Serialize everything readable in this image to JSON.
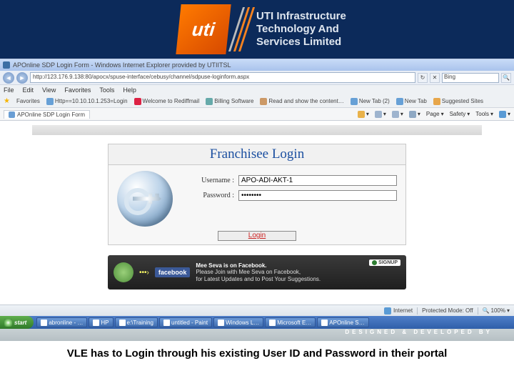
{
  "header": {
    "logo_text": "uti",
    "company_line1": "UTI Infrastructure",
    "company_line2": "Technology And",
    "company_line3": "Services Limited"
  },
  "browser": {
    "window_title": "APOnline SDP Login Form - Windows Internet Explorer provided by UTIITSL",
    "address": "http://123.176.9.138:80/apocx/spuse-interface/cebusy/channel/sdpuse-loginform.aspx",
    "search_engine": "Bing",
    "menu": {
      "file": "File",
      "edit": "Edit",
      "view": "View",
      "favorites": "Favorites",
      "tools": "Tools",
      "help": "Help"
    },
    "favorites_label": "Favorites",
    "fav_links": {
      "l1": "Http==10.10.10.1.253=Login",
      "l2": "Welcome to Rediffmail",
      "l3": "Billing Software",
      "l4": "Read and show the content…",
      "l5": "New Tab (2)",
      "l6": "New Tab",
      "l7": "Suggested Sites"
    },
    "tab_label": "APOnline SDP Login Form",
    "toolbar": {
      "page": "Page",
      "safety": "Safety",
      "tools": "Tools"
    },
    "status": {
      "zone": "Internet",
      "protected": "Protected Mode: Off",
      "zoom": "100%"
    }
  },
  "login": {
    "title": "Franchisee Login",
    "username_label": "Username :",
    "password_label": "Password :",
    "username_value": "APO-ADI-AKT-1",
    "password_value": "••••••••",
    "button": "Login"
  },
  "fb_banner": {
    "brand": "facebook",
    "line1_a": "Mee Seva is on ",
    "line1_b": "Facebook.",
    "line2": "Please Join with Mee Seva on Facebook,",
    "line3": "for Latest Updates and to Post Your Suggestions.",
    "signup": "SIGNUP"
  },
  "footer_dev": "DESIGNED & DEVELOPED BY",
  "taskbar": {
    "start": "start",
    "items": {
      "i1": "abronline - …",
      "i2": "HP",
      "i3": "e:\\Training",
      "i4": "untitled - Paint",
      "i5": "Windows L…",
      "i6": "Microsoft E…",
      "i7": "APOnline S…"
    }
  },
  "caption": "VLE has to Login through his existing User ID and Password in their portal"
}
